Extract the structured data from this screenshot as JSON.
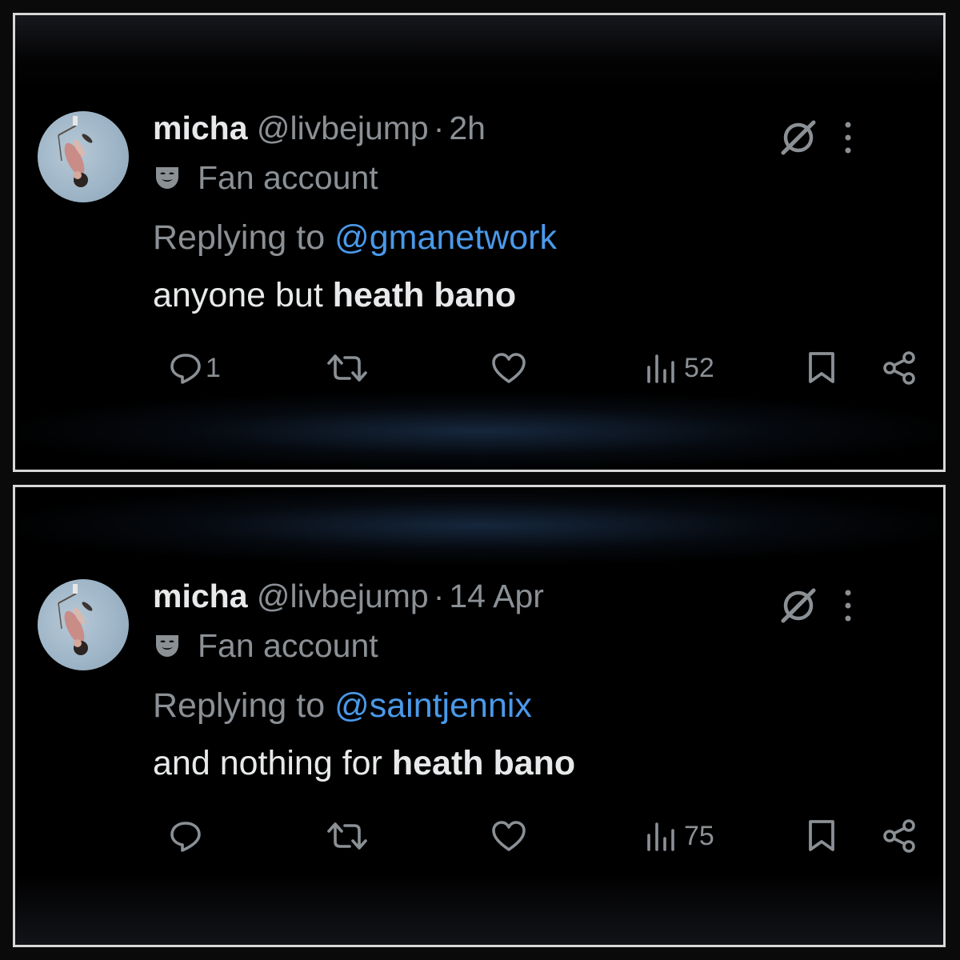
{
  "tweets": [
    {
      "name": "micha",
      "handle": "@livbejump",
      "separator": "·",
      "time": "2h",
      "label": "Fan account",
      "replying_prefix": "Replying to ",
      "replying_to": "@gmanetwork",
      "text_plain": "anyone but ",
      "text_bold": "heath bano",
      "replies": "1",
      "views": "52",
      "icons": [
        "grok-icon",
        "more-icon",
        "reply-icon",
        "retweet-icon",
        "like-icon",
        "views-icon",
        "bookmark-icon",
        "share-icon",
        "fan-mask-icon"
      ]
    },
    {
      "name": "micha",
      "handle": "@livbejump",
      "separator": "·",
      "time": "14 Apr",
      "label": "Fan account",
      "replying_prefix": "Replying to ",
      "replying_to": "@saintjennix",
      "text_plain": "and nothing for ",
      "text_bold": "heath bano",
      "replies": "",
      "views": "75",
      "icons": [
        "grok-icon",
        "more-icon",
        "reply-icon",
        "retweet-icon",
        "like-icon",
        "views-icon",
        "bookmark-icon",
        "share-icon",
        "fan-mask-icon"
      ]
    }
  ],
  "colors": {
    "background": "#000000",
    "frame": "#d8d8d8",
    "primary_text": "#e7e9ea",
    "secondary_text": "#8b9095",
    "mention": "#4a99e9"
  }
}
